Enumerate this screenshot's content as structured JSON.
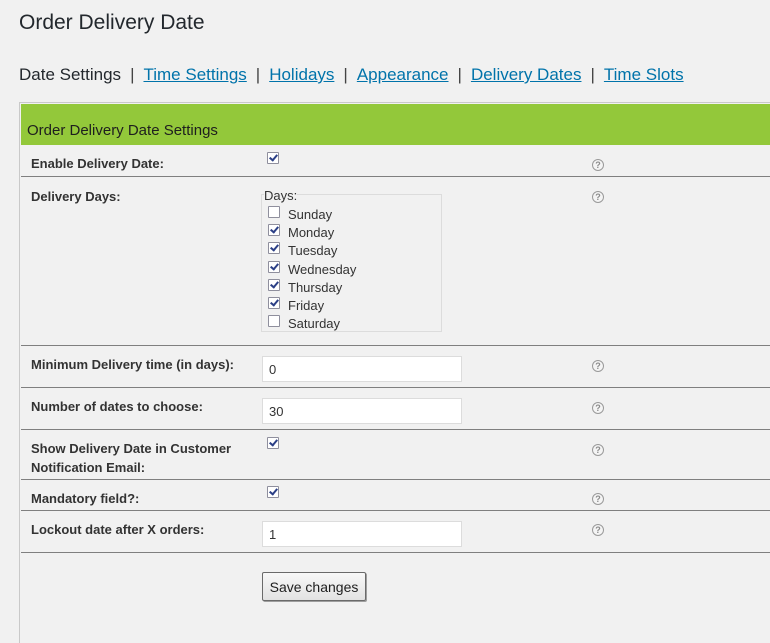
{
  "page": {
    "title": "Order Delivery Date"
  },
  "nav": {
    "current": "Date Settings",
    "separator": "|",
    "links": [
      "Time Settings",
      "Holidays",
      "Appearance",
      "Delivery Dates",
      "Time Slots"
    ]
  },
  "panel": {
    "title": "Order Delivery Date Settings",
    "header_color": "#93c83a"
  },
  "settings": {
    "enable_delivery_date": {
      "label": "Enable Delivery Date:",
      "checked": true
    },
    "delivery_days": {
      "label": "Delivery Days:",
      "legend": "Days:",
      "days": [
        {
          "name": "Sunday",
          "checked": false
        },
        {
          "name": "Monday",
          "checked": true
        },
        {
          "name": "Tuesday",
          "checked": true
        },
        {
          "name": "Wednesday",
          "checked": true
        },
        {
          "name": "Thursday",
          "checked": true
        },
        {
          "name": "Friday",
          "checked": true
        },
        {
          "name": "Saturday",
          "checked": false
        }
      ]
    },
    "minimum_delivery_time": {
      "label": "Minimum Delivery time (in days):",
      "value": "0"
    },
    "number_of_dates": {
      "label": "Number of dates to choose:",
      "value": "30"
    },
    "show_in_email": {
      "label_line1": "Show Delivery Date in Customer",
      "label_line2": "Notification Email:",
      "checked": true
    },
    "mandatory_field": {
      "label": "Mandatory field?:",
      "checked": true
    },
    "lockout_date": {
      "label": "Lockout date after X orders:",
      "value": "1"
    }
  },
  "help_icon": {
    "name": "question-mark-icon",
    "glyph": "?"
  },
  "actions": {
    "save_label": "Save changes"
  },
  "colors": {
    "link": "#0073aa",
    "header": "#93c83a",
    "check": "#2b3f86"
  }
}
